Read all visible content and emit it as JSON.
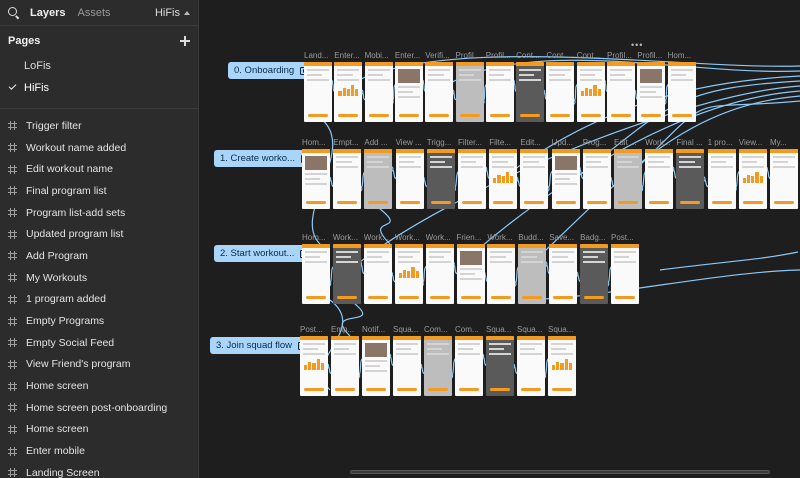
{
  "topbar": {
    "layers_tab": "Layers",
    "assets_tab": "Assets",
    "current_page": "HiFis"
  },
  "pages": {
    "heading": "Pages",
    "items": [
      {
        "label": "LoFis",
        "selected": false
      },
      {
        "label": "HiFis",
        "selected": true
      }
    ]
  },
  "layers": [
    "Trigger filter",
    "Workout name added",
    "Edit workout name",
    "Final program list",
    "Program list-add sets",
    "Updated program list",
    "Add Program",
    "My Workouts",
    "1 program added",
    "Empty Programs",
    "Empty Social Feed",
    "View Friend's program",
    "Home screen",
    "Home screen post-onboarding",
    "Home screen",
    "Enter mobile",
    "Landing Screen"
  ],
  "flows": [
    {
      "label": "0. Onboarding",
      "frames": [
        "Land...",
        "Enter...",
        "Mobi...",
        "Enter...",
        "Verifi...",
        "Profil...",
        "Profil...",
        "Cont...",
        "Cont...",
        "Cont...",
        "Profil...",
        "Profil...",
        "Hom..."
      ]
    },
    {
      "label": "1. Create worko...",
      "frames": [
        "Hom...",
        "Empt...",
        "Add ...",
        "View ...",
        "Trigg...",
        "Filter...",
        "Filte...",
        "Edit...",
        "Upd...",
        "Prog...",
        "Edit ...",
        "Work...",
        "Final ...",
        "1 pro...",
        "View...",
        "My..."
      ]
    },
    {
      "label": "2. Start workout...",
      "frames": [
        "Hom...",
        "Work...",
        "Work...",
        "Work...",
        "Work...",
        "Frien...",
        "Work...",
        "Budd...",
        "Save...",
        "Badg...",
        "Post..."
      ]
    },
    {
      "label": "3. Join squad flow",
      "frames": [
        "Post...",
        "Emp...",
        "Notif...",
        "Squa...",
        "Com...",
        "Com...",
        "Squa...",
        "Squa...",
        "Squa..."
      ]
    }
  ],
  "colors": {
    "accent": "#f39a21",
    "flow_badge": "#a9d5fb",
    "connector": "#8cc8f5"
  }
}
